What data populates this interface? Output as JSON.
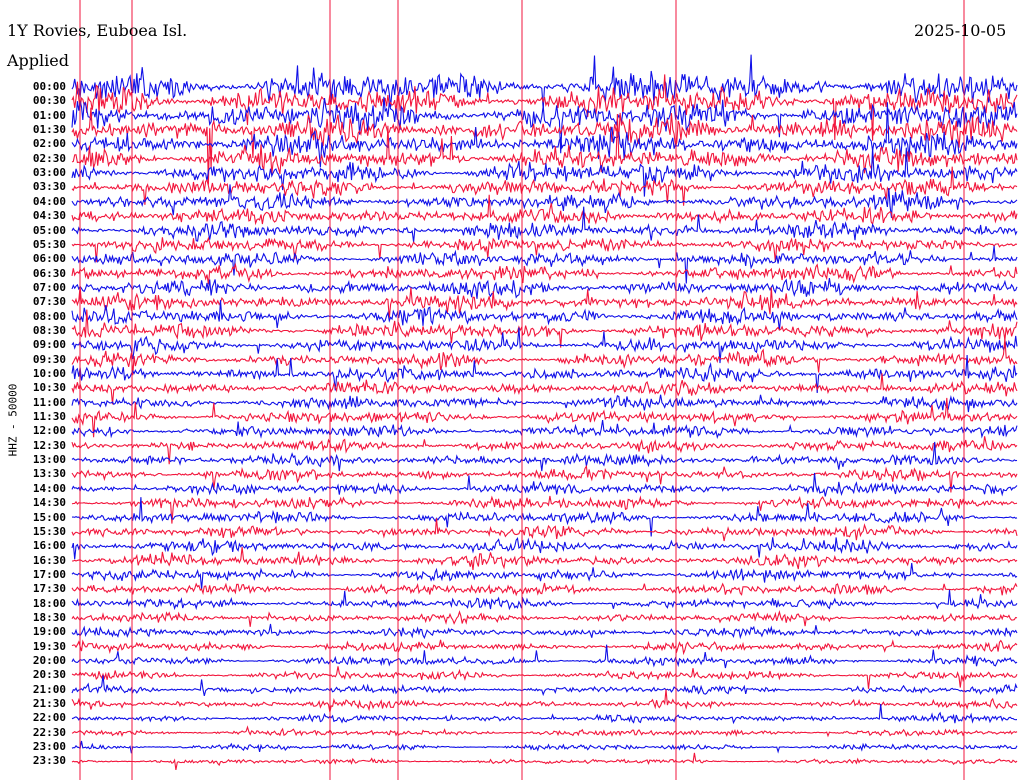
{
  "header": {
    "title": "1Y Rovies, Euboea Isl.",
    "date": "2025-10-05",
    "filter_text": "Applied"
  },
  "chart_data": {
    "type": "line",
    "chart_kind": "helicorder",
    "ylabel": "HHZ - 50000",
    "row_labels": [
      "00:00",
      "00:30",
      "01:00",
      "01:30",
      "02:00",
      "02:30",
      "03:00",
      "03:30",
      "04:00",
      "04:30",
      "05:00",
      "05:30",
      "06:00",
      "06:30",
      "07:00",
      "07:30",
      "08:00",
      "08:30",
      "09:00",
      "09:30",
      "10:00",
      "10:30",
      "11:00",
      "11:30",
      "12:00",
      "12:30",
      "13:00",
      "13:30",
      "14:00",
      "14:30",
      "15:00",
      "15:30",
      "16:00",
      "16:30",
      "17:00",
      "17:30",
      "18:00",
      "18:30",
      "19:00",
      "19:30",
      "20:00",
      "20:30",
      "21:00",
      "21:30",
      "22:00",
      "22:30",
      "23:00",
      "23:30"
    ],
    "trace_colors": [
      "#1010e8",
      "#f2163c"
    ],
    "relative_amplitude": [
      1.9,
      1.8,
      1.7,
      1.6,
      1.5,
      1.4,
      1.2,
      1.05,
      1.0,
      1.0,
      0.95,
      0.95,
      0.9,
      0.9,
      0.95,
      1.0,
      1.0,
      0.95,
      0.9,
      0.85,
      0.85,
      0.8,
      0.75,
      0.75,
      0.7,
      0.7,
      0.7,
      0.7,
      0.7,
      0.7,
      0.7,
      0.7,
      0.75,
      0.75,
      0.7,
      0.65,
      0.6,
      0.55,
      0.55,
      0.55,
      0.5,
      0.5,
      0.5,
      0.5,
      0.45,
      0.4,
      0.35,
      0.3
    ],
    "grid": false,
    "legend": "none"
  }
}
